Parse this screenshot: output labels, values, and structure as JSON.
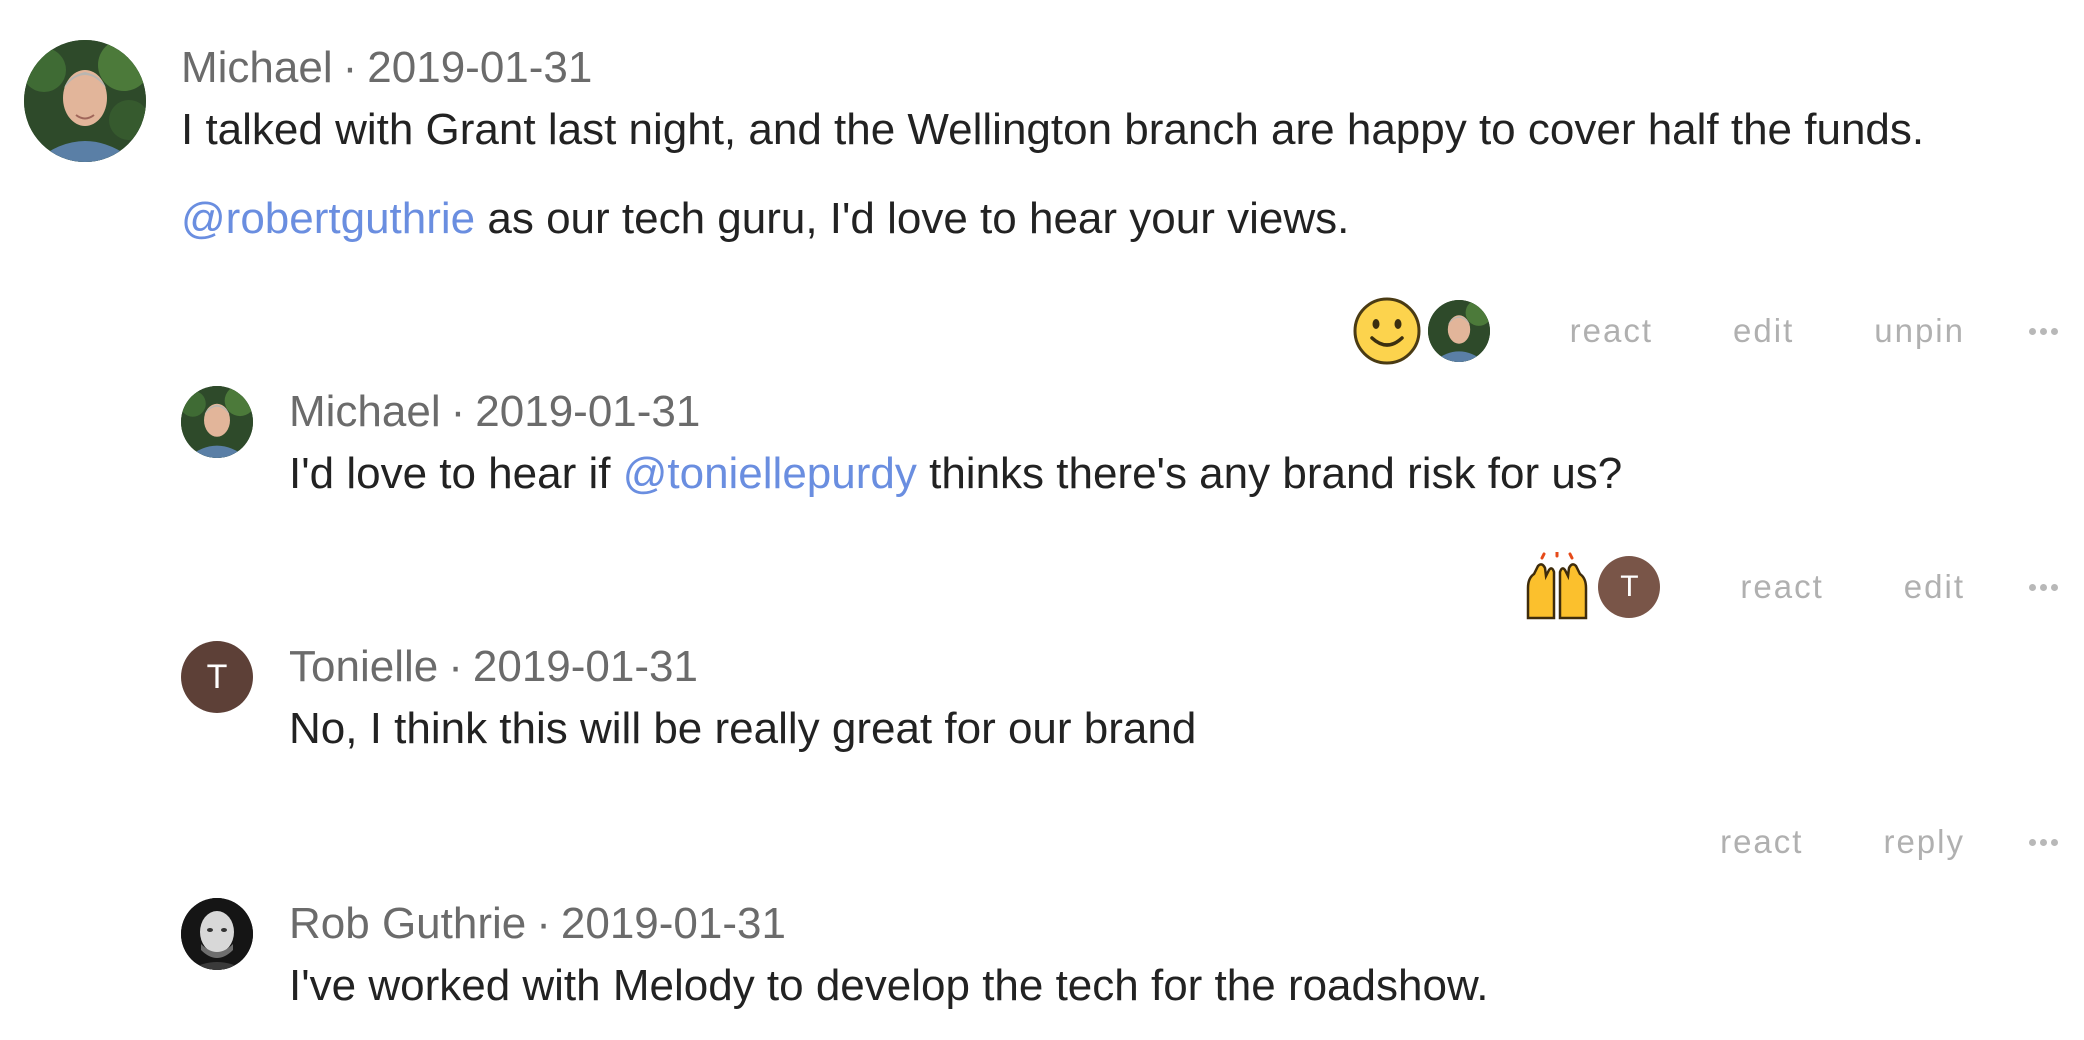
{
  "comments": [
    {
      "author": "Michael",
      "date": "2019-01-31",
      "separator": "·",
      "lines": [
        "I talked with Grant last night, and the Wellington branch are happy to cover half the funds."
      ],
      "mention": "@robertguthrie",
      "after_mention": " as our tech guru, I'd love to hear your views.",
      "reaction": {
        "icon": "slightly-smiling-face-icon",
        "by": "Michael"
      },
      "actions": [
        "react",
        "edit",
        "unpin"
      ]
    },
    {
      "author": "Michael",
      "date": "2019-01-31",
      "separator": "·",
      "before_mention": "I'd love to hear if ",
      "mention": "@toniellepurdy",
      "after_mention": " thinks there's any brand risk for us?",
      "reaction": {
        "icon": "raising-hands-icon",
        "by_initial": "T"
      },
      "actions": [
        "react",
        "edit"
      ]
    },
    {
      "author": "Tonielle",
      "initial": "T",
      "date": "2019-01-31",
      "separator": "·",
      "text": "No, I think this will be really great for our brand",
      "actions": [
        "react",
        "reply"
      ]
    },
    {
      "author": "Rob Guthrie",
      "date": "2019-01-31",
      "separator": "·",
      "text": "I've worked with Melody to develop the tech for the roadshow."
    }
  ],
  "colors": {
    "mention": "#6a8ee0",
    "meta": "#6b6b6b",
    "action": "#b0b0b0",
    "tonielle_avatar": "#5d4037"
  }
}
